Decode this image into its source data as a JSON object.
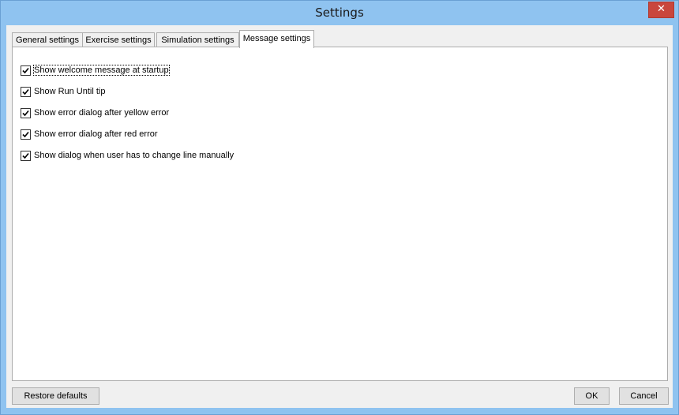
{
  "window": {
    "title": "Settings",
    "close_glyph": "✕"
  },
  "tabs": [
    {
      "label": "General settings",
      "active": false
    },
    {
      "label": "Exercise settings",
      "active": false
    },
    {
      "label": "Simulation settings",
      "active": false
    },
    {
      "label": "Message settings",
      "active": true
    }
  ],
  "options": [
    {
      "label": "Show welcome message at startup",
      "checked": true,
      "focused": true
    },
    {
      "label": "Show Run Until tip",
      "checked": true
    },
    {
      "label": "Show error dialog after yellow error",
      "checked": true
    },
    {
      "label": "Show error dialog after red error",
      "checked": true
    },
    {
      "label": "Show dialog when user has to change line manually",
      "checked": true
    }
  ],
  "footer": {
    "restore_label": "Restore defaults",
    "ok_label": "OK",
    "cancel_label": "Cancel"
  },
  "colors": {
    "frame": "#8fc3f0",
    "close_button": "#c9463d",
    "client_bg": "#f0f0f0",
    "panel_bg": "#ffffff"
  },
  "icons": {
    "checkbox_mark": "check-icon",
    "close": "close-icon"
  }
}
